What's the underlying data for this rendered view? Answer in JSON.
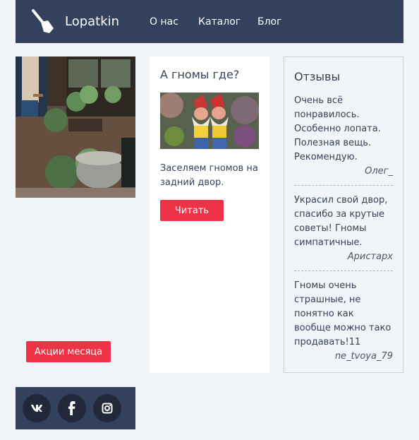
{
  "header": {
    "brand": "Lopatkin",
    "nav": [
      "О нас",
      "Каталог",
      "Блог"
    ]
  },
  "sidebar": {
    "promo_button": "Акции месяца",
    "social": [
      "vk",
      "facebook",
      "instagram"
    ]
  },
  "article": {
    "title": "А гномы где?",
    "text": "Заселяем гномов на задний двор.",
    "button": "Читать"
  },
  "reviews": {
    "title": "Отзывы",
    "items": [
      {
        "text": "Очень всё понравилось. Особенно лопата. Полезная вещь. Рекомендую.",
        "author": "Олег_"
      },
      {
        "text": "Украсил свой двор, спасибо за крутые советы! Гномы симпатичные.",
        "author": "Аристарх"
      },
      {
        "text": "Гномы очень страшные, не понятно как вообще можно тако продавать!11",
        "author": "ne_tvoya_79"
      }
    ]
  },
  "colors": {
    "header": "#33415c",
    "accent": "#ee3347",
    "background": "#f1f4f8",
    "text": "#36425a"
  },
  "icons": {
    "logo": "shovel-icon",
    "social": [
      "vk-icon",
      "facebook-icon",
      "instagram-icon"
    ]
  }
}
